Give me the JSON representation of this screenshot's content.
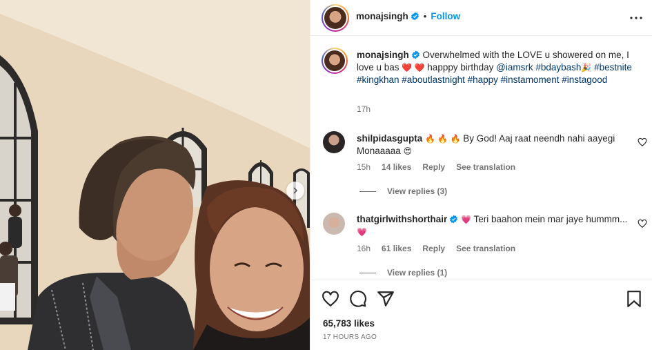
{
  "post": {
    "author": "monajsingh",
    "follow_label": "Follow",
    "separator": "•"
  },
  "caption": {
    "username": "monajsingh",
    "text_1": "Overwhelmed with the LOVE u showered on me, I love u bas",
    "hearts": "❤️ ❤️",
    "text_2": "happpy birthday",
    "mention": "@iamsrk",
    "tag_bdaybash": "#bdaybash",
    "emoji_party": "🎉",
    "tags_line": "#bestnite #kingkhan #aboutlastnight #happy #instamoment",
    "tag_instagood": "#instagood",
    "time": "17h"
  },
  "comments": [
    {
      "username": "shilpidasgupta",
      "emoji_prefix": "🔥 🔥 🔥",
      "text": "By God! Aaj raat neendh nahi aayegi Monaaaaa",
      "emoji_suffix": "😍",
      "time": "15h",
      "likes": "14 likes",
      "reply_label": "Reply",
      "translate_label": "See translation",
      "view_replies": "View replies (3)"
    },
    {
      "username": "thatgirlwithshorthair",
      "emoji_prefix": "💗",
      "text": "Teri baahon mein mar jaye hummm...",
      "emoji_suffix": "💗",
      "time": "16h",
      "likes": "61 likes",
      "reply_label": "Reply",
      "translate_label": "See translation",
      "view_replies": "View replies (1)"
    }
  ],
  "footer": {
    "likes": "65,783 likes",
    "date": "17 HOURS AGO"
  },
  "icons": {
    "verified": "verified-badge-icon",
    "more": "more-options-icon",
    "like": "heart-icon",
    "comment": "comment-icon",
    "share": "share-icon",
    "save": "bookmark-icon",
    "next": "chevron-right-icon"
  },
  "colors": {
    "accent": "#0095f6",
    "hashtag": "#00376b",
    "muted": "#737373",
    "verified": "#0095f6"
  }
}
